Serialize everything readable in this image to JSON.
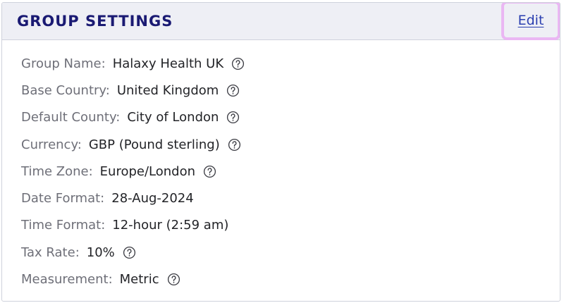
{
  "header": {
    "title": "GROUP SETTINGS",
    "edit_label": "Edit"
  },
  "settings": [
    {
      "label": "Group Name:",
      "value": "Halaxy Health UK",
      "help_icon": "question-circle-icon"
    },
    {
      "label": "Base Country:",
      "value": "United Kingdom",
      "help_icon": "question-circle-icon"
    },
    {
      "label": "Default County:",
      "value": "City of London",
      "help_icon": "question-circle-icon"
    },
    {
      "label": "Currency:",
      "value": "GBP (Pound sterling)",
      "help_icon": "question-circle-icon"
    },
    {
      "label": "Time Zone:",
      "value": "Europe/London",
      "help_icon": "question-circle-icon"
    },
    {
      "label": "Date Format:",
      "value": "28-Aug-2024"
    },
    {
      "label": "Time Format:",
      "value": "12-hour (2:59 am)"
    },
    {
      "label": "Tax Rate:",
      "value": "10%",
      "help_icon": "question-circle-icon"
    },
    {
      "label": "Measurement:",
      "value": "Metric",
      "help_icon": "question-circle-icon"
    }
  ],
  "colors": {
    "title": "#1a1a73",
    "link": "#2b3fb0",
    "highlight": "#eab7f3",
    "header_bg": "#eeeff5"
  }
}
